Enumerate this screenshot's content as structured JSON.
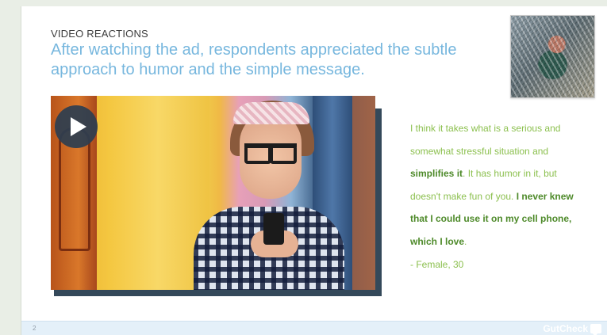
{
  "slide": {
    "overline": "VIDEO REACTIONS",
    "headline": "After watching the ad, respondents appreciated the subtle approach to humor and the simple message.",
    "page_number": "2"
  },
  "video": {
    "play_icon": "play-icon"
  },
  "quote": {
    "parts": [
      {
        "text": "I think it takes what is a serious and somewhat stressful situation and ",
        "bold": false
      },
      {
        "text": "simplifies it",
        "bold": true
      },
      {
        "text": ".  It has humor in it, but doesn't make fun of you.  ",
        "bold": false
      },
      {
        "text": "I never knew that I could use it on my cell phone, which I love",
        "bold": true
      },
      {
        "text": ".",
        "bold": false
      }
    ],
    "attribution": "- Female, 30"
  },
  "footer": {
    "brand": "GutCheck",
    "brand_icon": "speech-bubble-icon"
  },
  "colors": {
    "headline": "#77b7de",
    "quote": "#8cc04f",
    "quote_bold": "#4e8a2a",
    "play_button": "#2c3e50",
    "video_shadow": "#34495a",
    "footer_bg": "#e4f0f9"
  }
}
